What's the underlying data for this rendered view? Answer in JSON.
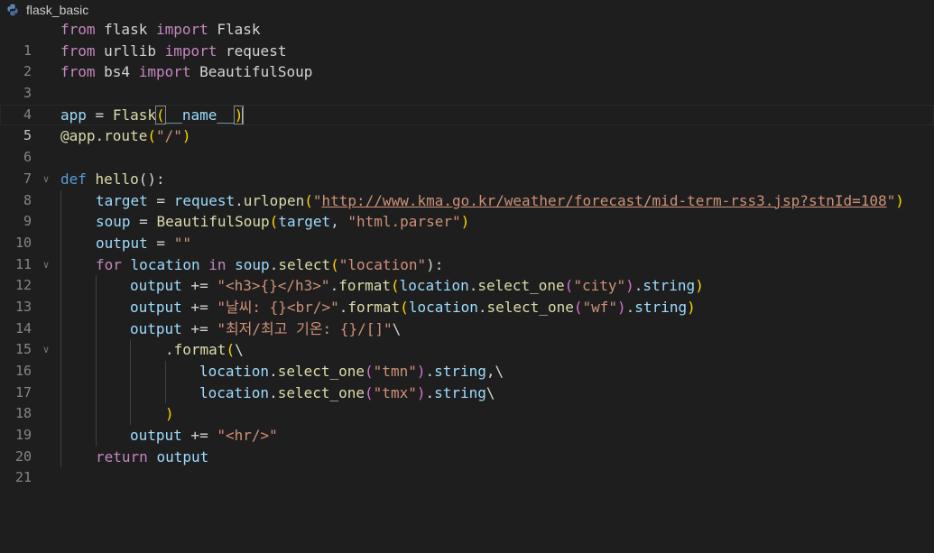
{
  "tab": {
    "title": "flask_basic",
    "icon": "python-file-icon"
  },
  "editor": {
    "current_line": 5,
    "lines": [
      {
        "n": "1"
      },
      {
        "n": "2"
      },
      {
        "n": "3"
      },
      {
        "n": "4"
      },
      {
        "n": "5"
      },
      {
        "n": "6"
      },
      {
        "n": "7"
      },
      {
        "n": "8"
      },
      {
        "n": "9"
      },
      {
        "n": "10"
      },
      {
        "n": "11"
      },
      {
        "n": "12"
      },
      {
        "n": "13"
      },
      {
        "n": "14"
      },
      {
        "n": "15"
      },
      {
        "n": "16"
      },
      {
        "n": "17"
      },
      {
        "n": "18"
      },
      {
        "n": "19"
      },
      {
        "n": "20"
      },
      {
        "n": "21"
      }
    ],
    "code": {
      "l1": [
        "from",
        " flask ",
        "import",
        " Flask"
      ],
      "l2": [
        "from",
        " urllib ",
        "import",
        " request"
      ],
      "l3": [
        "from",
        " bs4 ",
        "import",
        " BeautifulSoup"
      ],
      "l5": [
        "app",
        " = ",
        "Flask",
        "(",
        "__name__",
        ")"
      ],
      "l6": [
        "@app.route",
        "(",
        "\"/\"",
        ")"
      ],
      "l8": [
        "def",
        " ",
        "hello",
        "():"
      ],
      "l9": [
        "target",
        " = ",
        "request",
        ".",
        "urlopen",
        "(",
        "\"",
        "http://www.kma.go.kr/weather/forecast/mid-term-rss3.jsp?stnId=108",
        "\"",
        ")"
      ],
      "l10": [
        "soup",
        " = ",
        "BeautifulSoup",
        "(",
        "target",
        ", ",
        "\"html.parser\"",
        ")"
      ],
      "l11": [
        "output",
        " = ",
        "\"\""
      ],
      "l12": [
        "for",
        " ",
        "location",
        " ",
        "in",
        " ",
        "soup",
        ".",
        "select",
        "(",
        "\"location\"",
        "):"
      ],
      "l13": [
        "output",
        " += ",
        "\"<h3>{}</h3>\"",
        ".",
        "format",
        "(",
        "location",
        ".",
        "select_one",
        "(",
        "\"city\"",
        ")",
        ".",
        "string",
        ")"
      ],
      "l14": [
        "output",
        " += ",
        "\"날씨: {}<br/>\"",
        ".",
        "format",
        "(",
        "location",
        ".",
        "select_one",
        "(",
        "\"wf\"",
        ")",
        ".",
        "string",
        ")"
      ],
      "l15": [
        "output",
        " += ",
        "\"최저/최고 기온: {}/[]\"",
        "\\"
      ],
      "l16": [
        ".",
        "format",
        "(",
        "\\"
      ],
      "l17": [
        "location",
        ".",
        "select_one",
        "(",
        "\"tmn\"",
        ")",
        ".",
        "string",
        ",\\"
      ],
      "l18": [
        "location",
        ".",
        "select_one",
        "(",
        "\"tmx\"",
        ")",
        ".",
        "string",
        "\\"
      ],
      "l19": [
        ")"
      ],
      "l20": [
        "output",
        " += ",
        "\"<hr/>\""
      ],
      "l21": [
        "return",
        " ",
        "output"
      ]
    }
  },
  "colors": {
    "background": "#1e1e1e",
    "keyword": "#569cd6",
    "control": "#c586c0",
    "function": "#dcdcaa",
    "variable": "#9cdcfe",
    "string": "#ce9178"
  }
}
